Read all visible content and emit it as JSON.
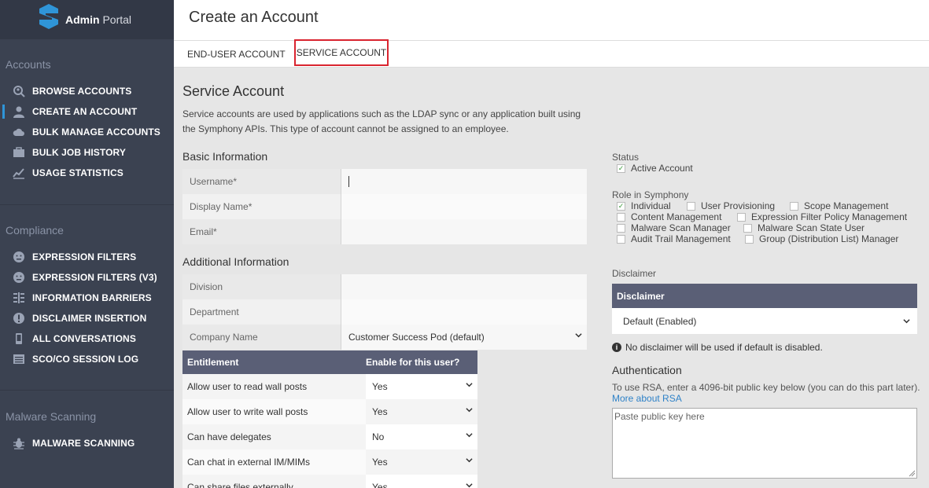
{
  "app": {
    "name_bold": "Admin",
    "name_light": " Portal"
  },
  "sidebar": {
    "sections": [
      {
        "label": "Accounts"
      },
      {
        "label": "Compliance"
      },
      {
        "label": "Malware Scanning"
      }
    ],
    "accounts_items": [
      {
        "label": "BROWSE ACCOUNTS",
        "icon": "search-user-icon"
      },
      {
        "label": "CREATE AN ACCOUNT",
        "icon": "user-icon"
      },
      {
        "label": "BULK MANAGE ACCOUNTS",
        "icon": "cloud-icon"
      },
      {
        "label": "BULK JOB HISTORY",
        "icon": "briefcase-icon"
      },
      {
        "label": "USAGE STATISTICS",
        "icon": "chart-icon"
      }
    ],
    "compliance_items": [
      {
        "label": "EXPRESSION FILTERS",
        "icon": "filter-face-icon"
      },
      {
        "label": "EXPRESSION FILTERS (V3)",
        "icon": "filter-face-icon"
      },
      {
        "label": "INFORMATION BARRIERS",
        "icon": "barrier-icon"
      },
      {
        "label": "DISCLAIMER INSERTION",
        "icon": "exclamation-icon"
      },
      {
        "label": "ALL CONVERSATIONS",
        "icon": "phone-icon"
      },
      {
        "label": "SCO/CO SESSION LOG",
        "icon": "log-icon"
      }
    ],
    "malware_items": [
      {
        "label": "MALWARE SCANNING",
        "icon": "bug-icon"
      }
    ]
  },
  "header": {
    "title": "Create an Account"
  },
  "tabs": [
    {
      "label": "END-USER ACCOUNT"
    },
    {
      "label": "SERVICE ACCOUNT"
    }
  ],
  "main": {
    "title": "Service Account",
    "description": "Service accounts are used by applications such as the LDAP sync or any application built using the Symphony APIs. This type of account cannot be assigned to an employee.",
    "basic_info": {
      "heading": "Basic Information",
      "fields": [
        {
          "label": "Username*",
          "value": ""
        },
        {
          "label": "Display Name*",
          "value": ""
        },
        {
          "label": "Email*",
          "value": ""
        }
      ]
    },
    "additional_info": {
      "heading": "Additional Information",
      "fields": [
        {
          "label": "Division",
          "value": ""
        },
        {
          "label": "Department",
          "value": ""
        },
        {
          "label": "Company Name",
          "value": "Customer Success Pod (default)"
        }
      ]
    },
    "entitlements": {
      "col1": "Entitlement",
      "col2": "Enable for this user?",
      "rows": [
        {
          "label": "Allow user to read wall posts",
          "value": "Yes"
        },
        {
          "label": "Allow user to write wall posts",
          "value": "Yes"
        },
        {
          "label": "Can have delegates",
          "value": "No"
        },
        {
          "label": "Can chat in external IM/MIMs",
          "value": "Yes"
        },
        {
          "label": "Can share files externally",
          "value": "Yes"
        }
      ]
    }
  },
  "right": {
    "status_label": "Status",
    "status_option": {
      "label": "Active Account",
      "checked": true
    },
    "role_label": "Role in Symphony",
    "roles": [
      {
        "label": "Individual",
        "checked": true
      },
      {
        "label": "User Provisioning",
        "checked": false
      },
      {
        "label": "Scope Management",
        "checked": false
      },
      {
        "label": "Content Management",
        "checked": false
      },
      {
        "label": "Expression Filter Policy Management",
        "checked": false
      },
      {
        "label": "Malware Scan Manager",
        "checked": false
      },
      {
        "label": "Malware Scan State User",
        "checked": false
      },
      {
        "label": "Audit Trail Management",
        "checked": false
      },
      {
        "label": "Group (Distribution List) Manager",
        "checked": false
      }
    ],
    "disclaimer_label": "Disclaimer",
    "disclaimer_head": "Disclaimer",
    "disclaimer_value": "Default (Enabled)",
    "disclaimer_info": "No disclaimer will be used if default is disabled.",
    "auth_heading": "Authentication",
    "auth_desc": "To use RSA, enter a 4096-bit public key below (you can do this part later).",
    "auth_link": "More about RSA",
    "pubkey_placeholder": "Paste public key here"
  },
  "colors": {
    "sidebar_bg": "#3b4251",
    "table_header_bg": "#5a5f76",
    "active_tab_border": "#d9242f",
    "link": "#2f82c8",
    "check": "#3a9a3a"
  }
}
